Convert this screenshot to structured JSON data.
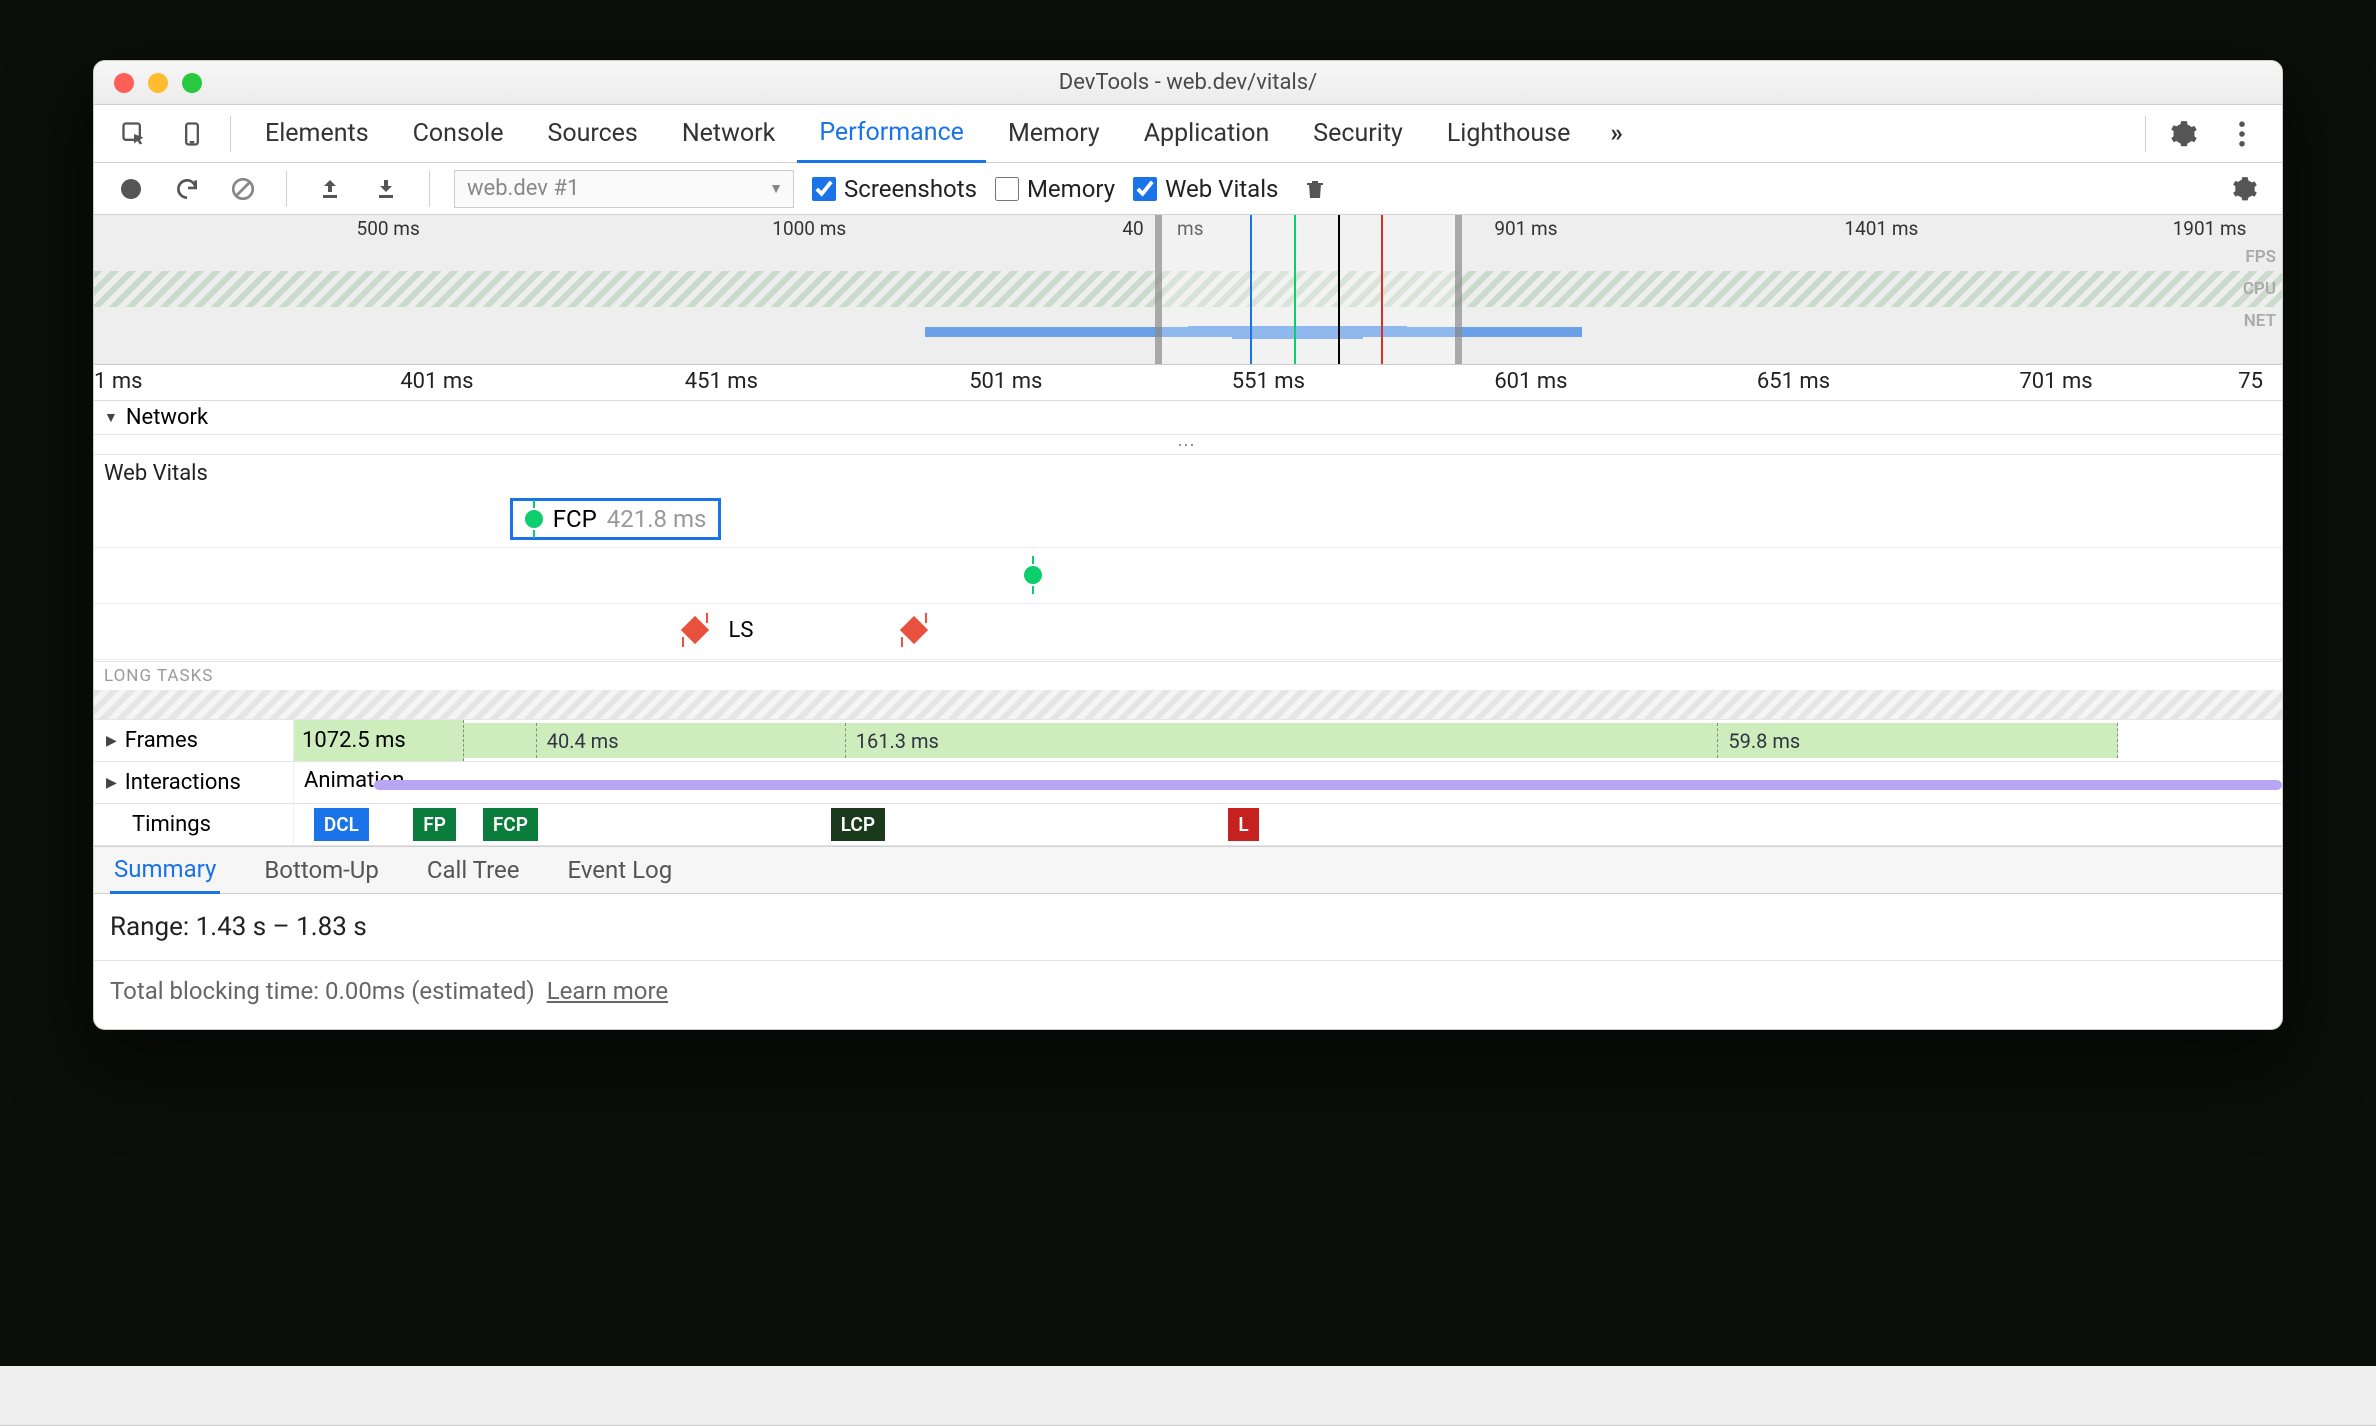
{
  "window": {
    "title": "DevTools - web.dev/vitals/"
  },
  "traffic": {
    "close": "#ff5f57",
    "min": "#febc2e",
    "max": "#28c840"
  },
  "tabs": [
    "Elements",
    "Console",
    "Sources",
    "Network",
    "Performance",
    "Memory",
    "Application",
    "Security",
    "Lighthouse"
  ],
  "activeTab": "Performance",
  "moreTabsGlyph": "»",
  "toolbar": {
    "sessionLabel": "web.dev #1",
    "screenshots": {
      "label": "Screenshots",
      "checked": true
    },
    "memory": {
      "label": "Memory",
      "checked": false
    },
    "webvitals": {
      "label": "Web Vitals",
      "checked": true
    }
  },
  "overview": {
    "ticks": [
      {
        "label": "500 ms",
        "pct": 12
      },
      {
        "label": "1000 ms",
        "pct": 31
      },
      {
        "label": "40",
        "pct": 47
      },
      {
        "label": "ms",
        "pct": 49.5
      },
      {
        "label": "901 ms",
        "pct": 64
      },
      {
        "label": "1401 ms",
        "pct": 80
      },
      {
        "label": "1901 ms",
        "pct": 95
      }
    ],
    "rightLabels": [
      "FPS",
      "CPU",
      "NET"
    ],
    "brush": {
      "leftPct": 48.5,
      "rightPct": 62.5
    },
    "netBars": [
      {
        "leftPct": 38,
        "widthPct": 30
      },
      {
        "leftPct": 50,
        "widthPct": 10
      },
      {
        "leftPct": 52,
        "widthPct": 6
      },
      {
        "leftPct": 54,
        "widthPct": 4
      }
    ]
  },
  "ruler": {
    "ticks": [
      {
        "label": "1 ms",
        "pct": 0
      },
      {
        "label": "401 ms",
        "pct": 14
      },
      {
        "label": "451 ms",
        "pct": 27
      },
      {
        "label": "501 ms",
        "pct": 40
      },
      {
        "label": "551 ms",
        "pct": 52
      },
      {
        "label": "601 ms",
        "pct": 64
      },
      {
        "label": "651 ms",
        "pct": 76
      },
      {
        "label": "701 ms",
        "pct": 88
      },
      {
        "label": "75",
        "pct": 98
      }
    ]
  },
  "sections": {
    "network": "Network",
    "webvitals": "Web Vitals",
    "longtasks": "LONG TASKS",
    "frames": "Frames",
    "interactions": "Interactions",
    "timings": "Timings"
  },
  "webvitals": {
    "fcp": {
      "label": "FCP",
      "value": "421.8 ms",
      "leftPct": 19
    },
    "greenDot2": {
      "leftPct": 42.5
    },
    "ls": {
      "label": "LS",
      "markers": [
        {
          "leftPct": 27
        },
        {
          "leftPct": 37
        }
      ]
    }
  },
  "frames": {
    "prefix": "1072.5 ms",
    "blocks": [
      {
        "label": "",
        "leftPct": 0,
        "widthPct": 4
      },
      {
        "label": "40.4 ms",
        "leftPct": 4,
        "widthPct": 17
      },
      {
        "label": "161.3 ms",
        "leftPct": 21,
        "widthPct": 48
      },
      {
        "label": "59.8 ms",
        "leftPct": 69,
        "widthPct": 22
      }
    ]
  },
  "interactions": {
    "label": "Animation",
    "bar": {
      "leftPct": 4,
      "widthPct": 96
    }
  },
  "timings": [
    {
      "label": "DCL",
      "color": "#1a73e8",
      "leftPct": 1
    },
    {
      "label": "FP",
      "color": "#0a7d3d",
      "leftPct": 6
    },
    {
      "label": "FCP",
      "color": "#0a7d3d",
      "leftPct": 9.5
    },
    {
      "label": "LCP",
      "color": "#1b3a1b",
      "leftPct": 27
    },
    {
      "label": "L",
      "color": "#c5221f",
      "leftPct": 47
    }
  ],
  "bottomTabs": [
    "Summary",
    "Bottom-Up",
    "Call Tree",
    "Event Log"
  ],
  "bottomActive": "Summary",
  "summary": {
    "range": "Range: 1.43 s – 1.83 s"
  },
  "footer": {
    "text": "Total blocking time: 0.00ms (estimated)",
    "link": "Learn more"
  }
}
